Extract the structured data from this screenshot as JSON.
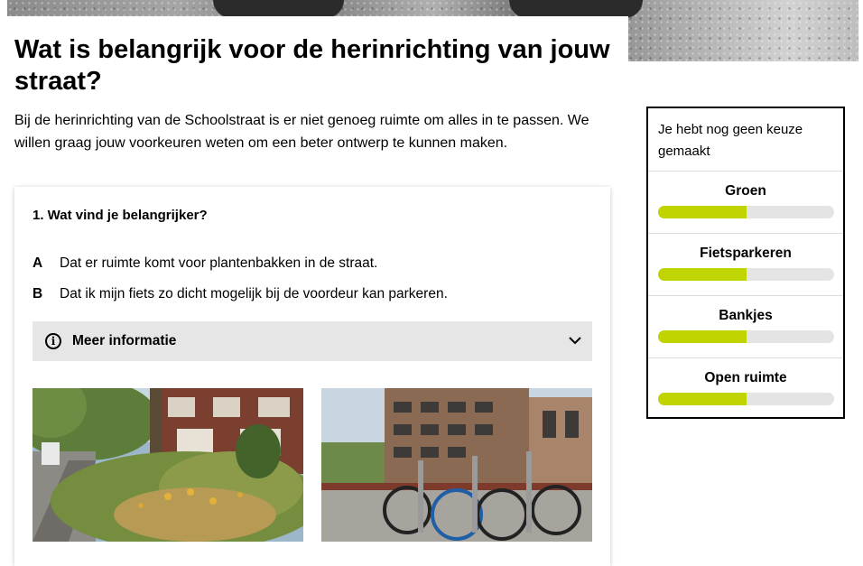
{
  "page": {
    "title": "Wat is belangrijk voor de herinrichting van jouw straat?",
    "intro": "Bij de herinrichting van de Schoolstraat is er niet genoeg ruimte om alles in te passen. We willen graag jouw voorkeuren weten om een beter ontwerp te kunnen maken."
  },
  "question": {
    "title": "1. Wat vind je belangrijker?",
    "options": [
      {
        "letter": "A",
        "text": "Dat er ruimte komt voor plantenbakken in de straat."
      },
      {
        "letter": "B",
        "text": "Dat ik mijn fiets zo dicht mogelijk bij de voordeur kan parkeren."
      }
    ],
    "more_info_label": "Meer informatie",
    "more_info_icon": "info-icon",
    "images": [
      {
        "name": "planters-photo"
      },
      {
        "name": "bicycle-parking-photo"
      }
    ]
  },
  "sidebar": {
    "status": "Je hebt nog geen keuze gemaakt",
    "priorities": [
      {
        "label": "Groen",
        "level": 0.5
      },
      {
        "label": "Fietsparkeren",
        "level": 0.5
      },
      {
        "label": "Bankjes",
        "level": 0.5
      },
      {
        "label": "Open ruimte",
        "level": 0.5
      }
    ]
  },
  "colors": {
    "accent": "#bfd400",
    "track": "#e4e4e4",
    "panel": "#e6e6e6"
  }
}
